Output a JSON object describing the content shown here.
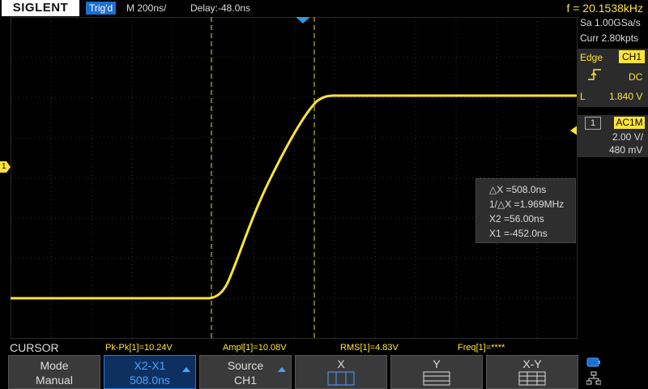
{
  "header": {
    "brand": "SIGLENT",
    "trigger_status": "Trig'd",
    "timebase": "M 200ns/",
    "delay": "Delay:-48.0ns",
    "frequency": "f = 20.1538kHz"
  },
  "acquisition": {
    "sample_rate": "Sa 1.00GSa/s",
    "memory": "Curr 2.80kpts"
  },
  "trigger": {
    "type": "Edge",
    "source": "CH1",
    "coupling": "DC",
    "level_label": "L",
    "level": "1.840 V"
  },
  "channel": {
    "number": "1",
    "coupling": "AC1M",
    "scale": "2.00 V/",
    "offset": "480 mV"
  },
  "channel_marker": "1",
  "cursor_readout": {
    "delta_x": "△X =508.0ns",
    "inv_delta_x": "1/△X =1.969MHz",
    "x2": "X2 =56.00ns",
    "x1": "X1 =-452.0ns"
  },
  "measurements": {
    "title": "CURSOR",
    "pkpk": "Pk-Pk[1]=10.24V",
    "ampl": "Ampl[1]=10.08V",
    "rms": "RMS[1]=4.83V",
    "freq": "Freq[1]=****"
  },
  "softkeys": {
    "mode_label": "Mode",
    "mode_value": "Manual",
    "cursor_label": "X2-X1",
    "cursor_value": "508.0ns",
    "source_label": "Source",
    "source_value": "CH1",
    "x_label": "X",
    "y_label": "Y",
    "xy_label": "X-Y"
  },
  "colors": {
    "trace": "#ffe436",
    "accent": "#1c6fd0",
    "panel": "#2b2b2b"
  }
}
